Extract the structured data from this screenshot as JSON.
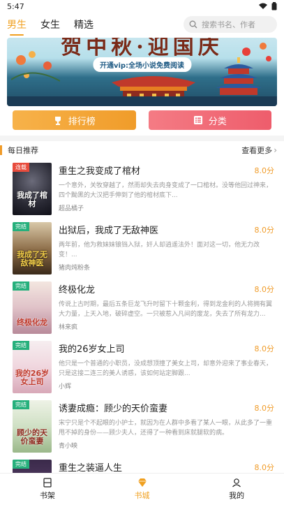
{
  "status": {
    "time": "5:47",
    "icons": [
      "wifi-icon",
      "battery-icon"
    ]
  },
  "tabs": [
    {
      "label": "男生",
      "active": true
    },
    {
      "label": "女生",
      "active": false
    },
    {
      "label": "精选",
      "active": false
    }
  ],
  "search": {
    "placeholder": "搜索书名、作者"
  },
  "banner": {
    "title": "贺中秋·迎国庆",
    "subtitle": "开通vip:全场小说免费阅读"
  },
  "actions": {
    "rank_label": "排行榜",
    "category_label": "分类"
  },
  "section": {
    "title": "每日推荐",
    "more_label": "查看更多"
  },
  "books": [
    {
      "tag": "连载",
      "title": "重生之我变成了棺材",
      "score": "8.0分",
      "desc": "一个意外，关牧穿越了，然而却失去肉身变成了一口棺材。没等他回过神来，四个黝黑的大汉把手伸到了他的棺材底下...",
      "author": "超品橘子",
      "cover_title": "我成了棺材"
    },
    {
      "tag": "完结",
      "title": "出狱后，我成了无敌神医",
      "score": "8.0分",
      "desc": "两年前，他为救妹妹锒铛入狱，奸人却逍遥法外！面对这一切，他无力改变！...",
      "author": "猪肉炖粉条",
      "cover_title": "我成了无敌神医"
    },
    {
      "tag": "完结",
      "title": "终极化龙",
      "score": "8.0分",
      "desc": "传说上古时期，最后五条巨龙飞升时留下十颗金利，得到龙金利的人将拥有翼大力量，上天入地，破碎虚空。一只被惹入凡间的废龙，失去了所有龙力...",
      "author": "林来疯",
      "cover_title": "终极化龙"
    },
    {
      "tag": "完结",
      "title": "我的26岁女上司",
      "score": "8.0分",
      "desc": "他只是一个普通的小职员，没成想顶撞了美女上司，却意外迎来了事业春天，只是这接二连三的美人诱惑，该如何站定脚跟...",
      "author": "小辉",
      "cover_title": "我的26岁女上司"
    },
    {
      "tag": "完结",
      "title": "诱妻成瘾：顾少的天价蛮妻",
      "score": "8.0分",
      "desc": "宋宁只是个不起眼的小护士，就因为在人群中多看了某人一眼，从此多了一重甩不掉的身份——顾少夫人，还得了一种看到床就腿软的病。",
      "author": "青小映",
      "cover_title": "顾少的天价蛮妻"
    },
    {
      "tag": "完结",
      "title": "重生之装逼人生",
      "score": "8.0分",
      "desc": "",
      "author": "",
      "cover_title": ""
    }
  ],
  "nav": [
    {
      "label": "书架",
      "active": false
    },
    {
      "label": "书城",
      "active": true
    },
    {
      "label": "我的",
      "active": false
    }
  ],
  "colors": {
    "accent": "#f0a020",
    "rank": "#f09c2a",
    "category": "#ee5d6c",
    "tag_serial": "#e84c3d",
    "tag_done": "#26b07c"
  }
}
